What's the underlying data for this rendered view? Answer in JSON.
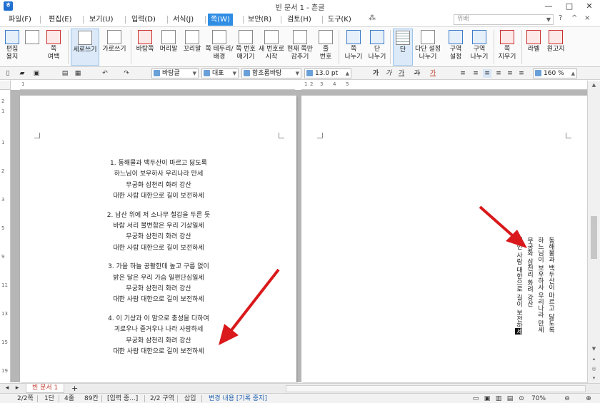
{
  "window": {
    "title": "빈 문서 1 - 흔글",
    "minimize": "—",
    "maximize": "□",
    "close": "✕"
  },
  "menu": {
    "items": [
      "파일(F)",
      "편집(E)",
      "보기(U)",
      "입력(D)",
      "서식(J)",
      "쪽(W)",
      "보안(R)",
      "검토(H)",
      "도구(K)"
    ],
    "active_index": 5,
    "search_placeholder": "위배"
  },
  "ribbon": {
    "buttons": [
      "편집\n용지",
      "쪽\n여백",
      "세로쓰기",
      "가로쓰기",
      "바탕쪽",
      "머리말",
      "꼬리말",
      "쪽 테두리/\n배경",
      "쪽 번호\n매기기",
      "새 번호로\n시작",
      "현재 쪽만\n감추기",
      "줄\n번호",
      "쪽\n나누기",
      "단\n나누기",
      "단",
      "다단 설정\n나누기",
      "구역\n설정",
      "구역\n나누기",
      "쪽\n지우기",
      "라벨",
      "원고지"
    ]
  },
  "format": {
    "style": "바탕글",
    "lang": "대표",
    "font": "함초롬바탕",
    "size": "13.0",
    "unit": "pt",
    "zoom": "160",
    "zoom_unit": "%",
    "bold": "가",
    "italic": "가",
    "underline": "가",
    "strike": "가",
    "color": "가"
  },
  "document": {
    "stanzas": [
      [
        "1. 동해물과 백두산이 마르고 닳도록",
        "하느님이 보우하사 우리나라 만세",
        "무궁화 삼천리 화려 강산",
        "대한 사람 대한으로 길이 보전하세"
      ],
      [
        "2. 남산 위에 저 소나무 철갑을 두른 듯",
        "바람 서리 불변함은 우리 기상일세",
        "무궁화 삼천리 화려 강산",
        "대한 사람 대한으로 길이 보전하세"
      ],
      [
        "3. 가을 하늘 공활한데 높고 구름 없이",
        "밝은 달은 우리 가슴 일편단심일세",
        "무궁화 삼천리 화려 강산",
        "대한 사람 대한으로 길이 보전하세"
      ],
      [
        "4. 이 기상과 이 맘으로 충성을 다하여",
        "괴로우나 즐거우나 나라 사랑하세",
        "무궁화 삼천리 화려 강산",
        "대한 사람 대한으로 길이 보전하세"
      ]
    ],
    "vertical_lines": [
      "동해물과 백두산이 마르고 닳도록",
      "하느님이 보우하사 우리나라 만세",
      "무궁화 삼천리 화려 강산",
      "대한 사람 대한으로 길이 보전하"
    ],
    "vertical_cursor_char": "세"
  },
  "tabs": {
    "doc_tab": "빈 문서 1",
    "add": "+"
  },
  "status": {
    "page": "2/2쪽",
    "column": "1단",
    "line": "4줄",
    "col": "89칸",
    "input": "[입력 중...]",
    "section": "2/2 구역",
    "insert": "삽입",
    "track": "변경 내용 [기록 중지]",
    "zoom": "70%"
  },
  "colors": {
    "accent": "#2f8de4",
    "arrow": "#d9191b",
    "tab_text": "#c0392b"
  }
}
